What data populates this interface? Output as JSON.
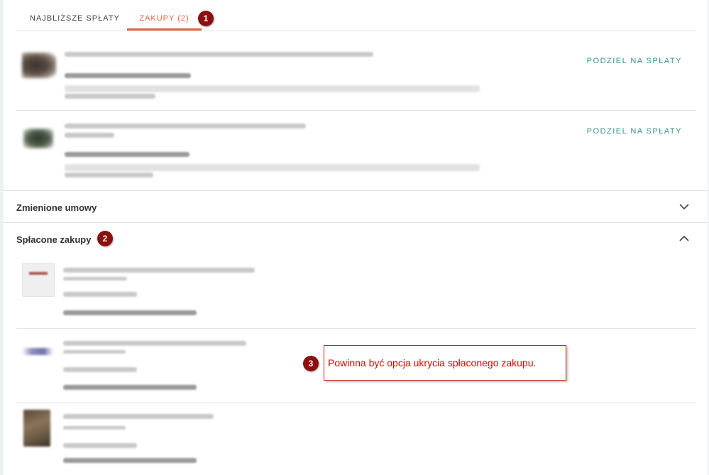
{
  "tabs": [
    {
      "label": "NAJBLIŻSZE SPŁATY",
      "active": false
    },
    {
      "label": "ZAKUPY (2)",
      "active": true
    }
  ],
  "annotations": {
    "badge_1": "1",
    "badge_2": "2",
    "badge_3": "3",
    "note": "Powinna być opcja ukrycia spłaconego zakupu."
  },
  "purchases": [
    {
      "action_label": "PODZIEL NA SPŁATY"
    },
    {
      "action_label": "PODZIEL NA SPŁATY"
    }
  ],
  "sections": {
    "changed_contracts": {
      "title": "Zmienione umowy",
      "expanded": false
    },
    "paid_purchases": {
      "title": "Spłacone zakupy",
      "expanded": true
    }
  },
  "colors": {
    "accent": "#e5643b",
    "action": "#3b8f86",
    "badge": "#8b1010",
    "annotation": "#e00000"
  }
}
